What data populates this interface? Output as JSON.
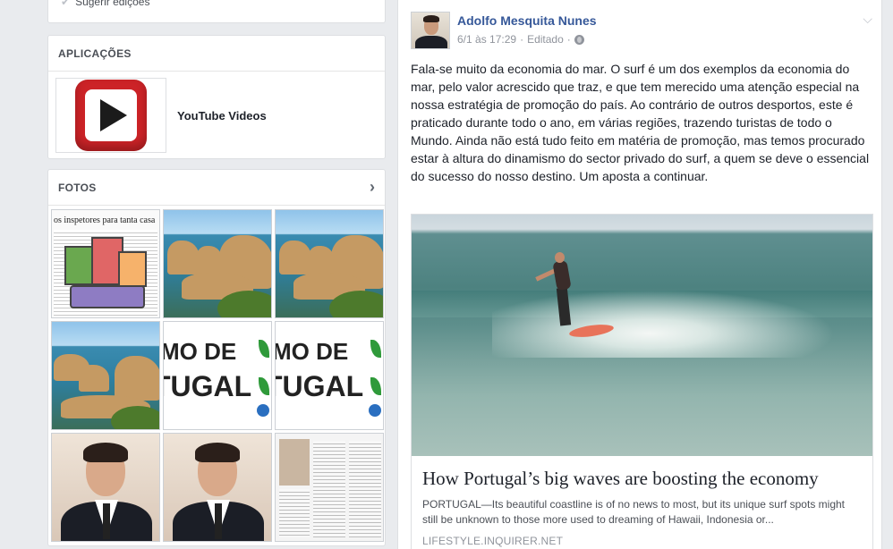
{
  "left": {
    "suggest_edits": "Sugerir edições",
    "apps": {
      "title": "APLICAÇÕES",
      "items": [
        {
          "name": "YouTube Videos",
          "icon": "youtube-icon"
        }
      ]
    },
    "photos": {
      "title": "FOTOS",
      "tiles": [
        {
          "type": "news",
          "headline": "os inspetores para tanta casa"
        },
        {
          "type": "coast"
        },
        {
          "type": "coast"
        },
        {
          "type": "coast"
        },
        {
          "type": "logo",
          "line1": "MO DE",
          "line2": "TUGAL"
        },
        {
          "type": "logo",
          "line1": "MO DE",
          "line2": "TUGAL"
        },
        {
          "type": "person"
        },
        {
          "type": "person"
        },
        {
          "type": "paper"
        }
      ]
    }
  },
  "post": {
    "author": "Adolfo Mesquita Nunes",
    "time": "6/1 às 17:29",
    "separator": "·",
    "edited": "Editado",
    "text": "Fala-se muito da economia do mar. O surf é um dos exemplos da economia do mar, pelo valor acrescido que traz, e que tem merecido uma atenção especial na nossa estratégia de promoção do país. Ao contrário de outros desportos, este é praticado durante todo o ano, em várias regiões, trazendo turistas de todo o Mundo. Ainda não está tudo feito em matéria de promoção, mas temos procurado estar à altura do dinamismo do sector privado do surf, a quem se deve o essencial do sucesso do nosso destino. Um aposta a continuar.",
    "link": {
      "title": "How Portugal’s big waves are boosting the economy",
      "description": "PORTUGAL—Its beautiful coastline is of no news to most, but its unique surf spots might still be unknown to those more used to dreaming of Hawaii, Indonesia or...",
      "source": "LIFESTYLE.INQUIRER.NET"
    }
  },
  "colors": {
    "link_blue": "#365899",
    "page_bg": "#e9ebee",
    "meta_gray": "#90949c"
  }
}
